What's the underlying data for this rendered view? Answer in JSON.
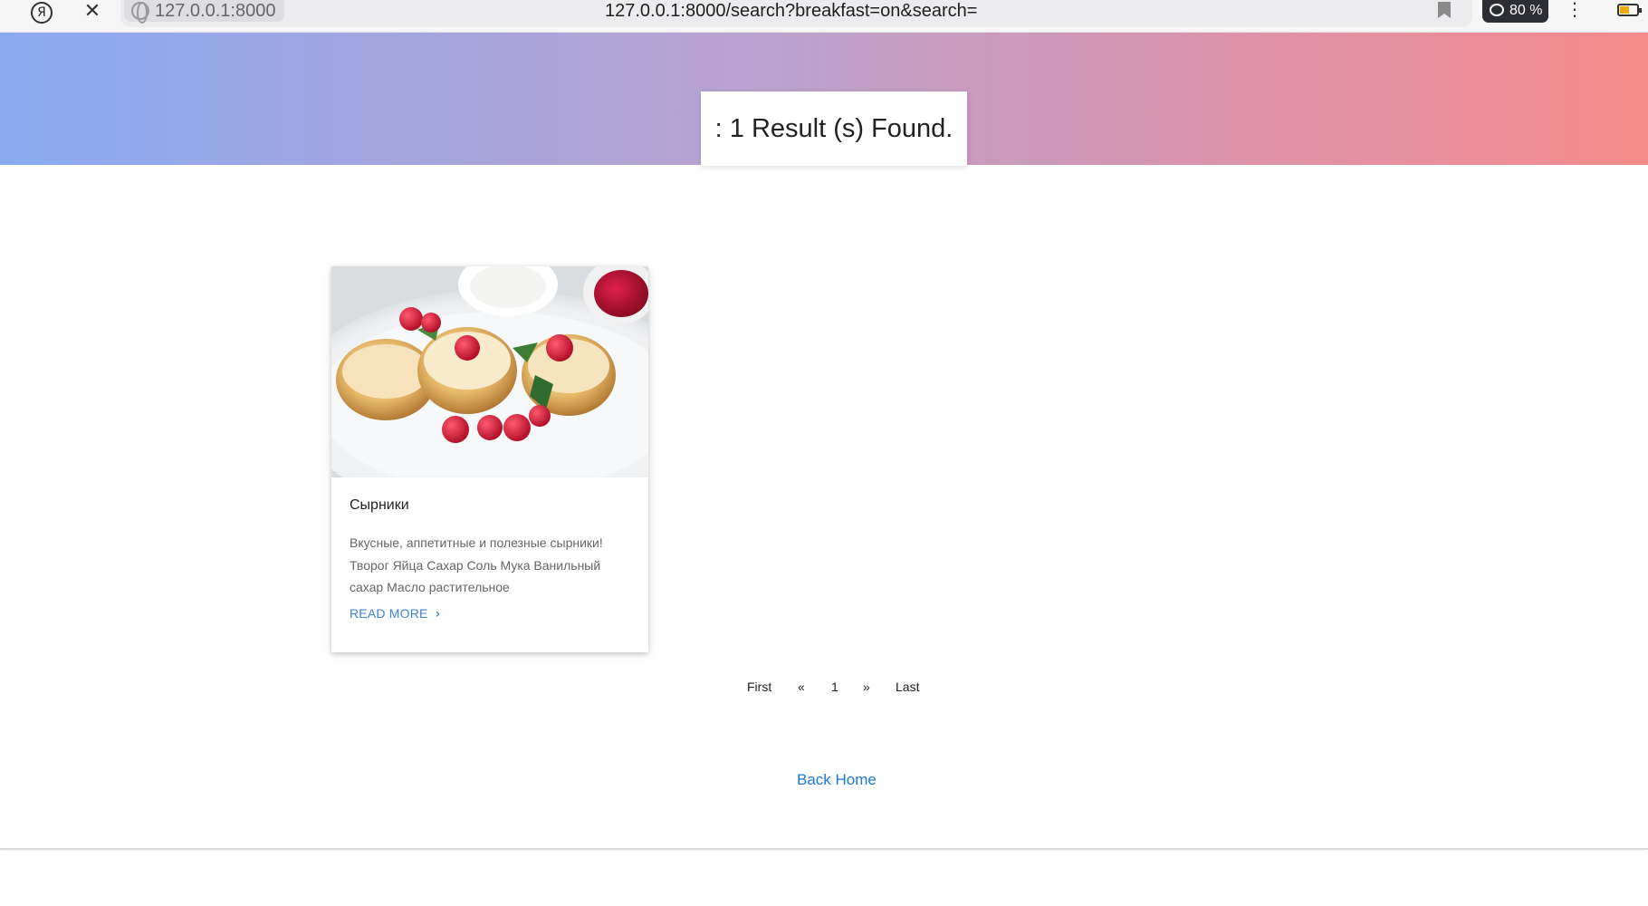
{
  "browser": {
    "site_chip": "127.0.0.1:8000",
    "url": "127.0.0.1:8000/search?breakfast=on&search=",
    "zoom": "80 %",
    "yandex_glyph": "Я",
    "close_glyph": "✕",
    "menu_glyph": "⋮"
  },
  "hero": {
    "result_text": ": 1 Result (s) Found.",
    "gradient_start": "#8aaaf0",
    "gradient_end": "#f58b8b"
  },
  "card": {
    "title": "Сырники",
    "description": "Вкусные, аппетитные и полезные сырники! Творог Яйца Сахар Соль Мука Ванильный сахар Масло растительное",
    "read_more": "READ MORE",
    "chevron_glyph": "›",
    "image_icon": "syrniki-photo"
  },
  "pagination": {
    "first": "First",
    "prev": "«",
    "current": "1",
    "next": "»",
    "last": "Last"
  },
  "footer": {
    "back_home": "Back Home"
  },
  "colors": {
    "link": "#1b79d0",
    "read_more": "#3d82d6"
  }
}
